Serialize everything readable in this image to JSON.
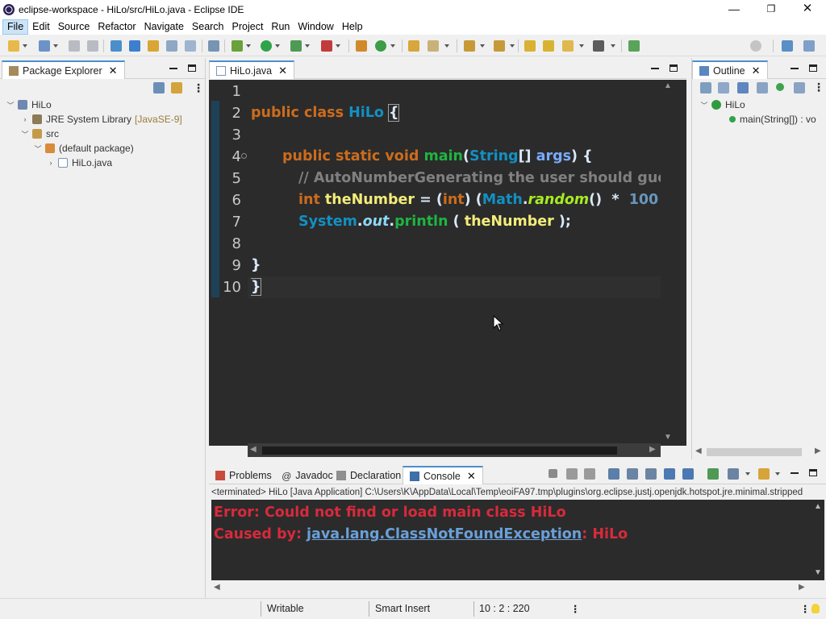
{
  "window": {
    "title": "eclipse-workspace - HiLo/src/HiLo.java - Eclipse IDE",
    "min_glyph": "—",
    "max_glyph": "❐",
    "close_glyph": "✕"
  },
  "menu": [
    "File",
    "Edit",
    "Source",
    "Refactor",
    "Navigate",
    "Search",
    "Project",
    "Run",
    "Window",
    "Help"
  ],
  "package_explorer": {
    "tab_label": "Package Explorer",
    "tree": [
      {
        "label": "HiLo",
        "decor": ""
      },
      {
        "label": "JRE System Library",
        "decor": "[JavaSE-9]"
      },
      {
        "label": "src",
        "decor": ""
      },
      {
        "label": "(default package)",
        "decor": ""
      },
      {
        "label": "HiLo.java",
        "decor": ""
      }
    ]
  },
  "editor": {
    "tab_label": "HiLo.java",
    "line_numbers": [
      "1",
      "2",
      "3",
      "4",
      "5",
      "6",
      "7",
      "8",
      "9",
      "10"
    ],
    "code": {
      "l2_kw": "public class ",
      "l2_cls": "HiLo",
      "l2_brace": "{",
      "l4_kw": "public static void ",
      "l4_mt": "main",
      "l4_p1": "(",
      "l4_cls": "String",
      "l4_p2": "[] ",
      "l4_var": "args",
      "l4_p3": ") {",
      "l5_cm": "// AutoNumberGenerating the user should gue",
      "l6_kw": "int ",
      "l6_var": "theNumber",
      "l6_p1": " = (",
      "l6_kw2": "int",
      "l6_p2": ") (",
      "l6_cls": "Math",
      "l6_p3": ".",
      "l6_it": "random",
      "l6_p4": "()  * ",
      "l6_nm": " 100 ",
      "l6_p5": " +",
      "l7_cls": "System",
      "l7_p1": ".",
      "l7_out": "out",
      "l7_p2": ".",
      "l7_mt": "println",
      "l7_p3": " ( ",
      "l7_var": "theNumber",
      "l7_p4": " );",
      "l9": "}",
      "l10": "}"
    }
  },
  "outline": {
    "tab_label": "Outline",
    "class_name": "HiLo",
    "method": "main(String[]) : vo"
  },
  "bottom_tabs": [
    "Problems",
    "Javadoc",
    "Declaration",
    "Console"
  ],
  "console": {
    "terminated_line": "<terminated> HiLo [Java Application] C:\\Users\\K\\AppData\\Local\\Temp\\eoiFA97.tmp\\plugins\\org.eclipse.justj.openjdk.hotspot.jre.minimal.stripped",
    "error_line1": "Error: Could not find or load main class HiLo",
    "error_line2_prefix": "Caused by: ",
    "error_line2_link": "java.lang.ClassNotFoundException",
    "error_line2_suffix": ": HiLo"
  },
  "status": {
    "writable": "Writable",
    "insert_mode": "Smart Insert",
    "position": "10 : 2 : 220"
  },
  "colors": {
    "editor_bg": "#2b2b2b",
    "keyword": "#cc6c1d",
    "class": "#1290c3",
    "method": "#1eb540",
    "variable": "#f3ec79",
    "error": "#d72a3c",
    "accent": "#4b8fd0"
  }
}
